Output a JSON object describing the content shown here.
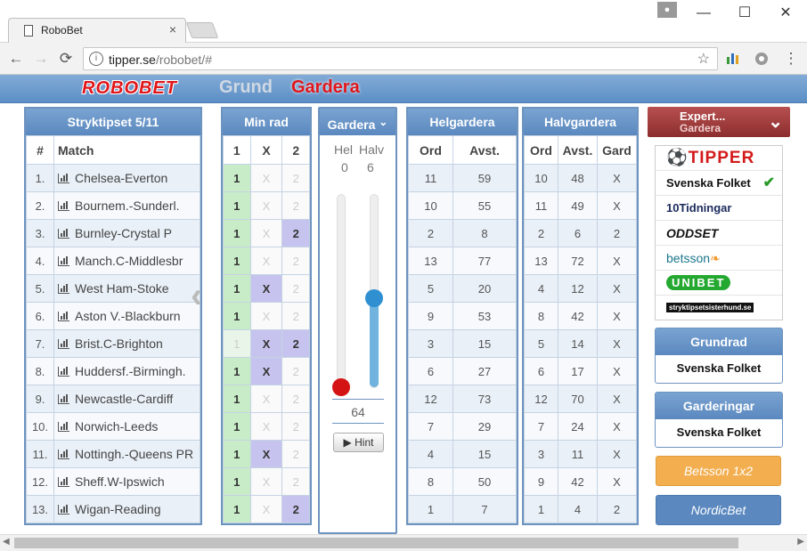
{
  "browser": {
    "tab_title": "RoboBet",
    "tab_close": "×",
    "url_host": "tipper.se",
    "url_path": "/robobet/#",
    "minimize": "—",
    "maximize": "☐",
    "close": "✕",
    "back": "←",
    "forward": "→",
    "reload": "⟳",
    "menu": "⋮",
    "star": "☆",
    "info": "i"
  },
  "app": {
    "logo": "ROBOBET",
    "nav_grund": "Grund",
    "nav_gardera": "Gardera"
  },
  "match_panel": {
    "title": "Stryktipset 5/11",
    "col_num": "#",
    "col_match": "Match",
    "rows": [
      {
        "num": "1.",
        "match": "Chelsea-Everton"
      },
      {
        "num": "2.",
        "match": "Bournem.-Sunderl."
      },
      {
        "num": "3.",
        "match": "Burnley-Crystal P"
      },
      {
        "num": "4.",
        "match": "Manch.C-Middlesbr"
      },
      {
        "num": "5.",
        "match": "West Ham-Stoke"
      },
      {
        "num": "6.",
        "match": "Aston V.-Blackburn"
      },
      {
        "num": "7.",
        "match": "Brist.C-Brighton"
      },
      {
        "num": "8.",
        "match": "Huddersf.-Birmingh."
      },
      {
        "num": "9.",
        "match": "Newcastle-Cardiff"
      },
      {
        "num": "10.",
        "match": "Norwich-Leeds"
      },
      {
        "num": "11.",
        "match": "Nottingh.-Queens PR"
      },
      {
        "num": "12.",
        "match": "Sheff.W-Ipswich"
      },
      {
        "num": "13.",
        "match": "Wigan-Reading"
      }
    ]
  },
  "minrad": {
    "title": "Min rad",
    "cols": [
      "1",
      "X",
      "2"
    ],
    "rows": [
      {
        "s1": true,
        "sx": false,
        "s2": false
      },
      {
        "s1": true,
        "sx": false,
        "s2": false
      },
      {
        "s1": true,
        "sx": false,
        "s2": true
      },
      {
        "s1": true,
        "sx": false,
        "s2": false
      },
      {
        "s1": true,
        "sx": true,
        "s2": false
      },
      {
        "s1": true,
        "sx": false,
        "s2": false
      },
      {
        "s1": false,
        "sx": true,
        "s2": true
      },
      {
        "s1": true,
        "sx": true,
        "s2": false
      },
      {
        "s1": true,
        "sx": false,
        "s2": false
      },
      {
        "s1": true,
        "sx": false,
        "s2": false
      },
      {
        "s1": true,
        "sx": true,
        "s2": false
      },
      {
        "s1": true,
        "sx": false,
        "s2": false
      },
      {
        "s1": true,
        "sx": false,
        "s2": true
      }
    ]
  },
  "gardera": {
    "title": "Gardera",
    "toggle": "⌄",
    "hel_label": "Hel",
    "halv_label": "Halv",
    "hel_value": "0",
    "halv_value": "6",
    "hel_level": 0.0,
    "halv_level": 0.46,
    "total": "64",
    "hint": "▶ Hint"
  },
  "helgardera": {
    "title": "Helgardera",
    "col_ord": "Ord",
    "col_avst": "Avst.",
    "rows": [
      {
        "ord": "11",
        "avst": "59"
      },
      {
        "ord": "10",
        "avst": "55"
      },
      {
        "ord": "2",
        "avst": "8"
      },
      {
        "ord": "13",
        "avst": "77"
      },
      {
        "ord": "5",
        "avst": "20"
      },
      {
        "ord": "9",
        "avst": "53"
      },
      {
        "ord": "3",
        "avst": "15"
      },
      {
        "ord": "6",
        "avst": "27"
      },
      {
        "ord": "12",
        "avst": "73"
      },
      {
        "ord": "7",
        "avst": "29"
      },
      {
        "ord": "4",
        "avst": "15"
      },
      {
        "ord": "8",
        "avst": "50"
      },
      {
        "ord": "1",
        "avst": "7"
      }
    ]
  },
  "halvgardera": {
    "title": "Halvgardera",
    "col_ord": "Ord",
    "col_avst": "Avst.",
    "col_gard": "Gard",
    "rows": [
      {
        "ord": "10",
        "avst": "48",
        "gard": "X"
      },
      {
        "ord": "11",
        "avst": "49",
        "gard": "X"
      },
      {
        "ord": "2",
        "avst": "6",
        "gard": "2"
      },
      {
        "ord": "13",
        "avst": "72",
        "gard": "X"
      },
      {
        "ord": "4",
        "avst": "12",
        "gard": "X"
      },
      {
        "ord": "8",
        "avst": "42",
        "gard": "X"
      },
      {
        "ord": "5",
        "avst": "14",
        "gard": "X"
      },
      {
        "ord": "6",
        "avst": "17",
        "gard": "X"
      },
      {
        "ord": "12",
        "avst": "70",
        "gard": "X"
      },
      {
        "ord": "7",
        "avst": "24",
        "gard": "X"
      },
      {
        "ord": "3",
        "avst": "11",
        "gard": "X"
      },
      {
        "ord": "9",
        "avst": "42",
        "gard": "X"
      },
      {
        "ord": "1",
        "avst": "4",
        "gard": "2"
      }
    ]
  },
  "expert": {
    "line1": "Expert...",
    "line2": "Gardera",
    "chevron": "≫",
    "brands": [
      "TIPPER",
      "Svenska Folket",
      "10Tidningar",
      "ODDSET",
      "betsson",
      "UNIBET",
      "stryktipsetsisterhund.se"
    ],
    "selected_check": "✔"
  },
  "grundrad": {
    "title": "Grundrad",
    "brand": "Svenska Folket"
  },
  "garderingar": {
    "title": "Garderingar",
    "brand": "Svenska Folket"
  },
  "buttons": {
    "betsson": "Betsson 1x2",
    "nordicbet": "NordicBet"
  },
  "colors": {
    "accent": "#5a88bf",
    "logo_red": "#e0161a",
    "sel_1": "#c8ecc8",
    "sel_x2": "#c6c4ee",
    "slider_fill": "#6fb3de",
    "hel_knob": "#d41414",
    "halv_knob": "#2f8fd0"
  }
}
